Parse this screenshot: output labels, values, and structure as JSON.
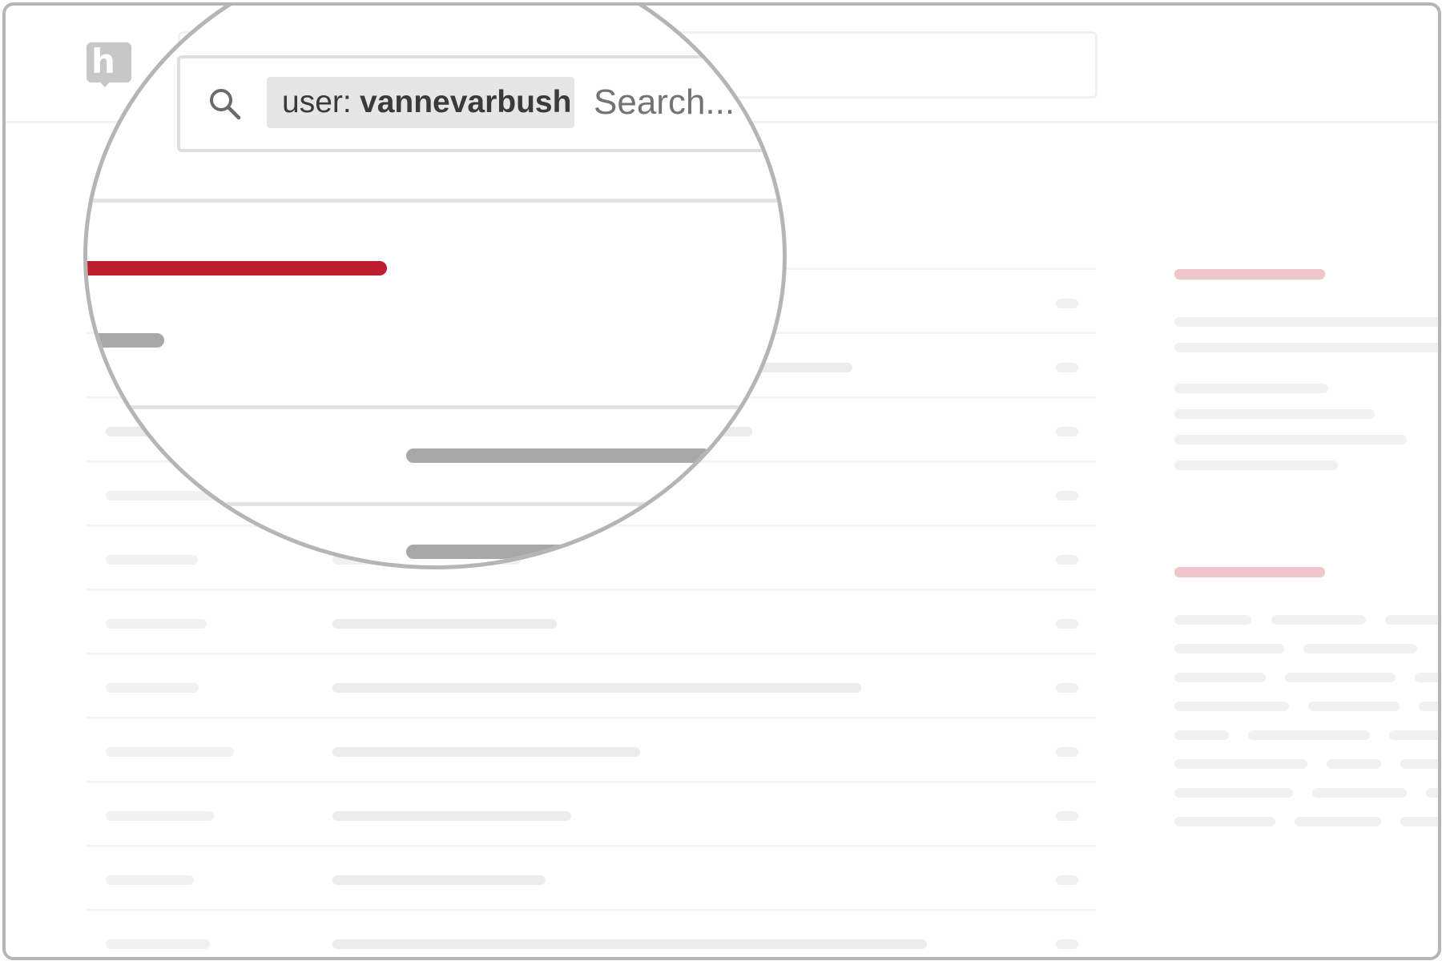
{
  "app": {
    "logo_letter": "h"
  },
  "search": {
    "filter_key": "user:",
    "filter_value": "vannevarbush",
    "placeholder": "Search..."
  },
  "colors": {
    "accent_red": "#bd1f30",
    "accent_pink_faded": "#eec6cb",
    "skeleton_gray": "#ececec",
    "frame_border": "#b5b5b5"
  },
  "icons": {
    "search": "magnifying-glass",
    "logo": "hypothesis-h"
  }
}
